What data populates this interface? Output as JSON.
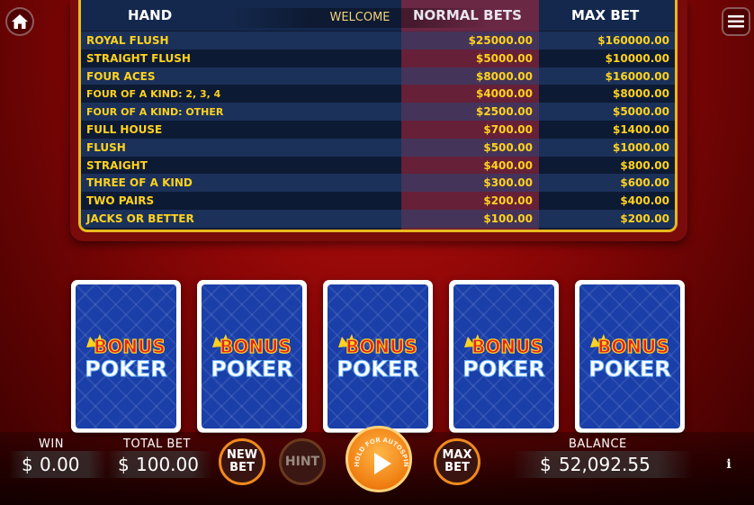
{
  "paytable": {
    "headers": {
      "hand": "HAND",
      "normal_bets": "NORMAL BETS",
      "max_bet": "MAX BET"
    },
    "welcome": "WELCOME",
    "rows": [
      {
        "hand": "ROYAL FLUSH",
        "normal": "$25000.00",
        "max": "$160000.00"
      },
      {
        "hand": "STRAIGHT FLUSH",
        "normal": "$5000.00",
        "max": "$10000.00"
      },
      {
        "hand": "FOUR ACES",
        "normal": "$8000.00",
        "max": "$16000.00"
      },
      {
        "hand": "FOUR OF A KIND: 2, 3, 4",
        "normal": "$4000.00",
        "max": "$8000.00"
      },
      {
        "hand": "FOUR OF A KIND: OTHER",
        "normal": "$2500.00",
        "max": "$5000.00"
      },
      {
        "hand": "FULL HOUSE",
        "normal": "$700.00",
        "max": "$1400.00"
      },
      {
        "hand": "FLUSH",
        "normal": "$500.00",
        "max": "$1000.00"
      },
      {
        "hand": "STRAIGHT",
        "normal": "$400.00",
        "max": "$800.00"
      },
      {
        "hand": "THREE OF A KIND",
        "normal": "$300.00",
        "max": "$600.00"
      },
      {
        "hand": "TWO PAIRS",
        "normal": "$200.00",
        "max": "$400.00"
      },
      {
        "hand": "JACKS OR BETTER",
        "normal": "$100.00",
        "max": "$200.00"
      }
    ]
  },
  "cards": {
    "logo_line1": "BONUS",
    "logo_line2": "POKER"
  },
  "bottom": {
    "win_label": "WIN",
    "win_currency": "$",
    "win_value": "0.00",
    "total_bet_label": "TOTAL BET",
    "total_bet_currency": "$",
    "total_bet_value": "100.00",
    "new_bet_line1": "NEW",
    "new_bet_line2": "BET",
    "hint_label": "HINT",
    "hold_text": "HOLD FOR AUTOSPIN",
    "max_bet_line1": "MAX",
    "max_bet_line2": "BET",
    "balance_label": "BALANCE",
    "balance_currency": "$",
    "balance_value": "52,092.55",
    "info_label": "i"
  },
  "icons": {
    "home": "home-icon",
    "menu": "menu-icon",
    "play": "play-icon"
  },
  "colors": {
    "accent_orange": "#f07d10",
    "paytable_gold": "#ffd21f",
    "card_blue": "#1a3fa8"
  }
}
